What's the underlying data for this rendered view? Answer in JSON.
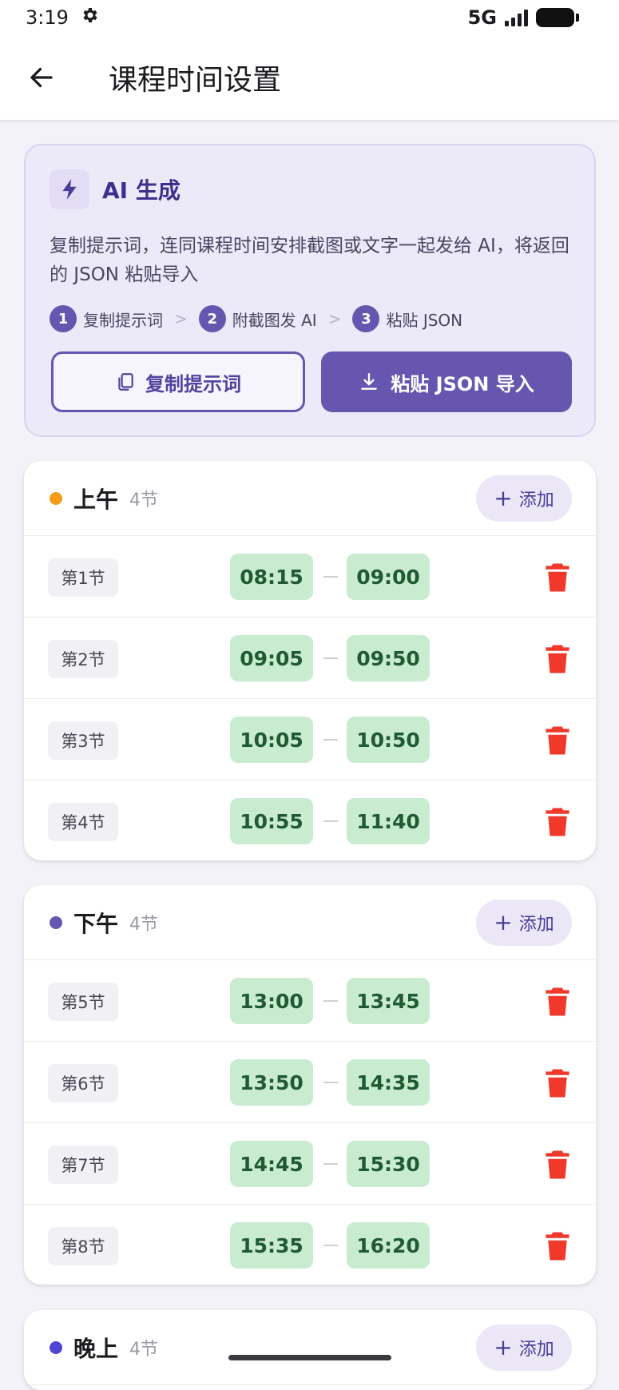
{
  "status_bar": {
    "time": "3:19",
    "network": "5G"
  },
  "app_bar": {
    "title": "课程时间设置"
  },
  "ai_card": {
    "title": "AI 生成",
    "description": "复制提示词，连同课程时间安排截图或文字一起发给 AI，将返回的 JSON 粘贴导入",
    "steps": [
      {
        "num": "1",
        "label": "复制提示词"
      },
      {
        "num": "2",
        "label": "附截图发 AI"
      },
      {
        "num": "3",
        "label": "粘贴 JSON"
      }
    ],
    "copy_button": "复制提示词",
    "paste_button": "粘贴 JSON 导入"
  },
  "sections": [
    {
      "title": "上午",
      "count": "4节",
      "add_label": "添加",
      "dot_color": "#f59c1a",
      "periods": [
        {
          "label": "第1节",
          "start": "08:15",
          "end": "09:00"
        },
        {
          "label": "第2节",
          "start": "09:05",
          "end": "09:50"
        },
        {
          "label": "第3节",
          "start": "10:05",
          "end": "10:50"
        },
        {
          "label": "第4节",
          "start": "10:55",
          "end": "11:40"
        }
      ]
    },
    {
      "title": "下午",
      "count": "4节",
      "add_label": "添加",
      "dot_color": "#6656b0",
      "periods": [
        {
          "label": "第5节",
          "start": "13:00",
          "end": "13:45"
        },
        {
          "label": "第6节",
          "start": "13:50",
          "end": "14:35"
        },
        {
          "label": "第7节",
          "start": "14:45",
          "end": "15:30"
        },
        {
          "label": "第8节",
          "start": "15:35",
          "end": "16:20"
        }
      ]
    },
    {
      "title": "晚上",
      "count": "4节",
      "add_label": "添加",
      "dot_color": "#4f46d8",
      "periods": []
    }
  ],
  "colors": {
    "primary": "#6656b0",
    "time_pill_bg": "#c9ecd1",
    "time_pill_text": "#1f5a32",
    "delete": "#f0392b"
  }
}
